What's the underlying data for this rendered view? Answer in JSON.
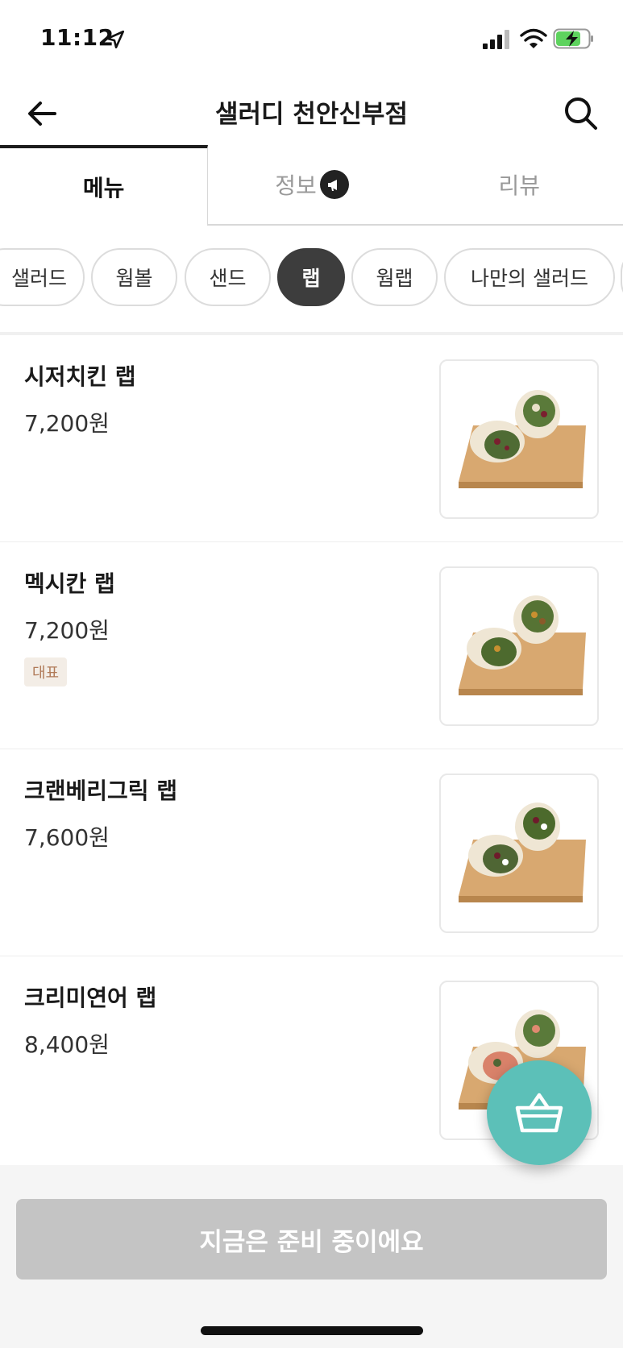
{
  "status_bar": {
    "time": "11:12",
    "icons": [
      "location-arrow-icon",
      "signal-icon",
      "wifi-icon",
      "battery-charging-icon"
    ]
  },
  "header": {
    "title": "샐러디 천안신부점",
    "back_icon": "back-arrow-icon",
    "search_icon": "search-icon"
  },
  "tabs": [
    {
      "label": "메뉴",
      "active": true
    },
    {
      "label": "정보",
      "active": false,
      "icon": "megaphone-icon"
    },
    {
      "label": "리뷰",
      "active": false
    }
  ],
  "categories": [
    {
      "label": "샐러드",
      "active": false
    },
    {
      "label": "웜볼",
      "active": false
    },
    {
      "label": "샌드",
      "active": false
    },
    {
      "label": "랩",
      "active": true
    },
    {
      "label": "웜랩",
      "active": false
    },
    {
      "label": "나만의 샐러드",
      "active": false
    }
  ],
  "menu_items": [
    {
      "name": "시저치킨 랩",
      "price": "7,200원",
      "badge": ""
    },
    {
      "name": "멕시칸 랩",
      "price": "7,200원",
      "badge": "대표"
    },
    {
      "name": "크랜베리그릭 랩",
      "price": "7,600원",
      "badge": ""
    },
    {
      "name": "크리미연어 랩",
      "price": "8,400원",
      "badge": ""
    }
  ],
  "cart_icon": "shopping-basket-icon",
  "bottom_button": {
    "label": "지금은 준비 중이에요"
  },
  "colors": {
    "accent_teal": "#5cc0b8",
    "active_chip": "#3d3d3d",
    "badge_bg": "#f3ede6",
    "badge_text": "#b07a58",
    "disabled_button": "#c4c4c4"
  }
}
